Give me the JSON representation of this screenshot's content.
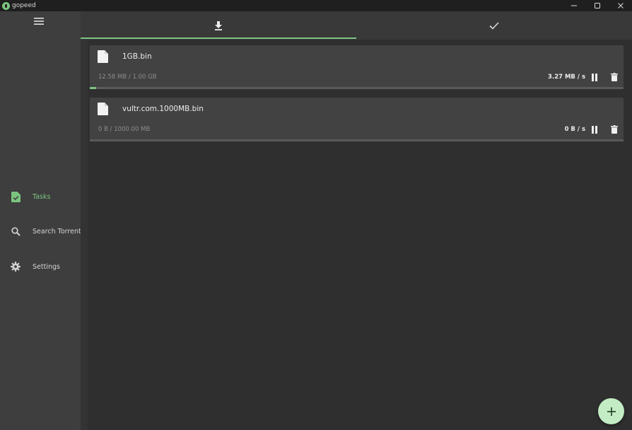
{
  "window": {
    "title": "gopeed",
    "controls": [
      "minimize-icon",
      "maximize-icon",
      "close-icon"
    ]
  },
  "sidebar": {
    "menu_icon": "menu-icon",
    "items": [
      {
        "label": "Tasks",
        "icon": "task-file-icon",
        "active": true
      },
      {
        "label": "Search Torrent",
        "icon": "search-icon",
        "active": false
      },
      {
        "label": "Settings",
        "icon": "gear-icon",
        "active": false
      }
    ]
  },
  "tabs": [
    {
      "icon": "download-icon",
      "active": true
    },
    {
      "icon": "check-icon",
      "active": false
    }
  ],
  "tasks": [
    {
      "name": "1GB.bin",
      "progress": "12.58 MB / 1.00 GB",
      "speed": "3.27 MB / s",
      "progress_fraction": 0.0123
    },
    {
      "name": "vultr.com.1000MB.bin",
      "progress": "0 B / 1000.00 MB",
      "speed": "0 B / s",
      "progress_fraction": 0
    }
  ],
  "fab": {
    "icon": "plus-icon"
  },
  "colors": {
    "accent": "#7ec483",
    "fab": "#c3ecc4",
    "background": "#2f2f2f",
    "sidebar": "#3e3e3e",
    "card": "#424242"
  }
}
